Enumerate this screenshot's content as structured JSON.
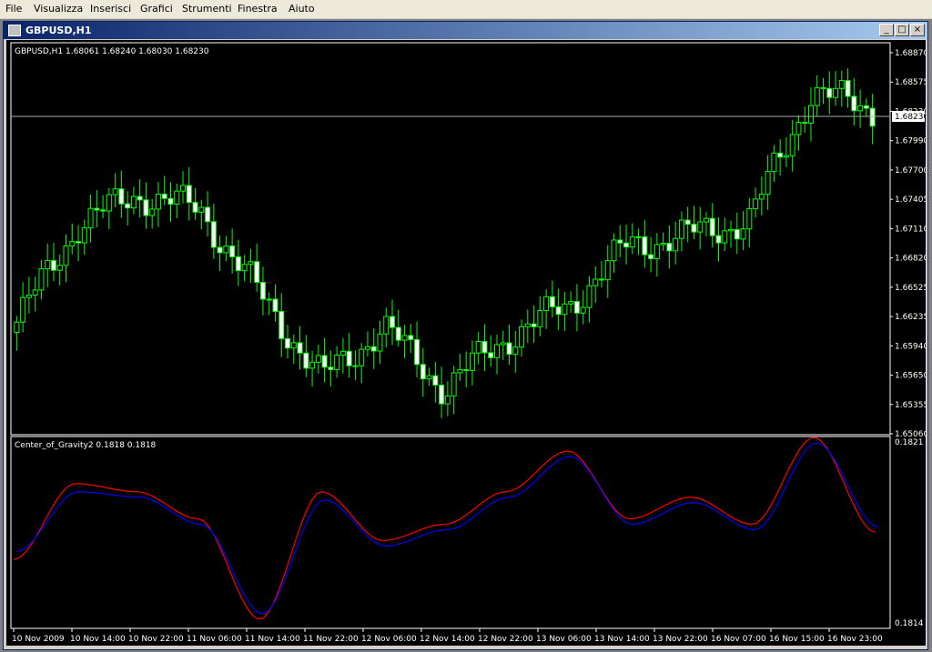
{
  "menu": [
    "File",
    "Visualizza",
    "Inserisci",
    "Grafici",
    "Strumenti",
    "Finestra",
    "Aiuto"
  ],
  "window": {
    "title": "GBPUSD,H1"
  },
  "main_panel": {
    "info": "GBPUSD,H1  1.68061 1.68240 1.68030 1.68230",
    "price_labels": [
      "1.68870",
      "1.68575",
      "1.68230",
      "1.67990",
      "1.67700",
      "1.67405",
      "1.67110",
      "1.66820",
      "1.66525",
      "1.66235",
      "1.65940",
      "1.65650",
      "1.65355",
      "1.65060"
    ],
    "current_price": "1.68230"
  },
  "indicator_panel": {
    "label": "Center_of_Gravity2 0.1818 0.1818",
    "top_label": "0.1821",
    "bottom_label": "0.1814"
  },
  "time_labels": [
    "10 Nov 2009",
    "10 Nov 14:00",
    "10 Nov 22:00",
    "11 Nov 06:00",
    "11 Nov 14:00",
    "11 Nov 22:00",
    "12 Nov 06:00",
    "12 Nov 14:00",
    "12 Nov 22:00",
    "13 Nov 06:00",
    "13 Nov 14:00",
    "13 Nov 22:00",
    "16 Nov 07:00",
    "16 Nov 15:00",
    "16 Nov 23:00"
  ],
  "chart_data": [
    {
      "type": "candlestick",
      "title": "GBPUSD,H1",
      "ylim": [
        1.6506,
        1.6887
      ],
      "x": [
        "10 Nov 2009",
        "10 Nov 14:00",
        "10 Nov 22:00",
        "11 Nov 06:00",
        "11 Nov 14:00",
        "11 Nov 22:00",
        "12 Nov 06:00",
        "12 Nov 14:00",
        "12 Nov 22:00",
        "13 Nov 06:00",
        "13 Nov 14:00",
        "13 Nov 22:00",
        "16 Nov 07:00",
        "16 Nov 15:00",
        "16 Nov 23:00"
      ],
      "close": [
        1.6615,
        1.671,
        1.674,
        1.6725,
        1.664,
        1.656,
        1.661,
        1.655,
        1.66,
        1.663,
        1.669,
        1.67,
        1.6715,
        1.684,
        1.6823
      ],
      "colors": {
        "up": "#00ff00",
        "down": "#ffffff"
      }
    },
    {
      "type": "line",
      "ylim": [
        0.1814,
        0.1821
      ],
      "x": [
        "10 Nov 2009",
        "10 Nov 14:00",
        "10 Nov 22:00",
        "11 Nov 06:00",
        "11 Nov 14:00",
        "11 Nov 22:00",
        "12 Nov 06:00",
        "12 Nov 14:00",
        "12 Nov 22:00",
        "13 Nov 06:00",
        "13 Nov 14:00",
        "13 Nov 22:00",
        "16 Nov 07:00",
        "16 Nov 15:00",
        "16 Nov 23:00"
      ],
      "series": [
        {
          "color": "#ff0000",
          "values": [
            0.18165,
            0.18193,
            0.1819,
            0.1818,
            0.18143,
            0.1819,
            0.18172,
            0.18178,
            0.1819,
            0.18205,
            0.1818,
            0.18188,
            0.18178,
            0.1821,
            0.18175
          ]
        },
        {
          "color": "#0000ff",
          "values": [
            0.18168,
            0.1819,
            0.18188,
            0.18178,
            0.18145,
            0.18187,
            0.1817,
            0.18176,
            0.18188,
            0.18203,
            0.18178,
            0.18186,
            0.18176,
            0.18208,
            0.18177
          ]
        }
      ]
    }
  ]
}
